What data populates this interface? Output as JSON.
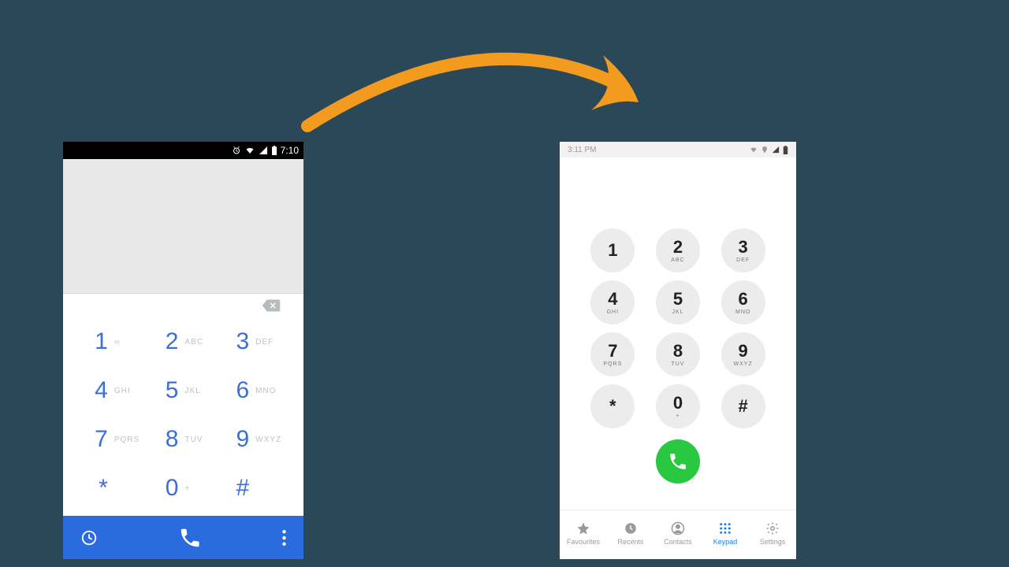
{
  "arrow_color": "#f29b1e",
  "left_phone": {
    "status_time": "7:10",
    "accent": "#3b6fd6",
    "bottombar": "#2b6be0",
    "keys": [
      {
        "d": "1",
        "t": "∞"
      },
      {
        "d": "2",
        "t": "ABC"
      },
      {
        "d": "3",
        "t": "DEF"
      },
      {
        "d": "4",
        "t": "GHI"
      },
      {
        "d": "5",
        "t": "JKL"
      },
      {
        "d": "6",
        "t": "MNO"
      },
      {
        "d": "7",
        "t": "PQRS"
      },
      {
        "d": "8",
        "t": "TUV"
      },
      {
        "d": "9",
        "t": "WXYZ"
      },
      {
        "d": "*",
        "t": ""
      },
      {
        "d": "0",
        "t": "+"
      },
      {
        "d": "#",
        "t": ""
      }
    ]
  },
  "right_phone": {
    "status_time": "3:11 PM",
    "call_color": "#28c940",
    "nav_active": "#1c7ee8",
    "keys": [
      {
        "d": "1",
        "t": ""
      },
      {
        "d": "2",
        "t": "ABC"
      },
      {
        "d": "3",
        "t": "DEF"
      },
      {
        "d": "4",
        "t": "GHI"
      },
      {
        "d": "5",
        "t": "JKL"
      },
      {
        "d": "6",
        "t": "MNO"
      },
      {
        "d": "7",
        "t": "PQRS"
      },
      {
        "d": "8",
        "t": "TUV"
      },
      {
        "d": "9",
        "t": "WXYZ"
      },
      {
        "d": "*",
        "t": ""
      },
      {
        "d": "0",
        "t": "+"
      },
      {
        "d": "#",
        "t": ""
      }
    ],
    "nav": [
      {
        "label": "Favourites",
        "icon": "star",
        "active": false
      },
      {
        "label": "Recents",
        "icon": "clock",
        "active": false
      },
      {
        "label": "Contacts",
        "icon": "contact",
        "active": false
      },
      {
        "label": "Keypad",
        "icon": "keypad",
        "active": true
      },
      {
        "label": "Settings",
        "icon": "gear",
        "active": false
      }
    ]
  }
}
